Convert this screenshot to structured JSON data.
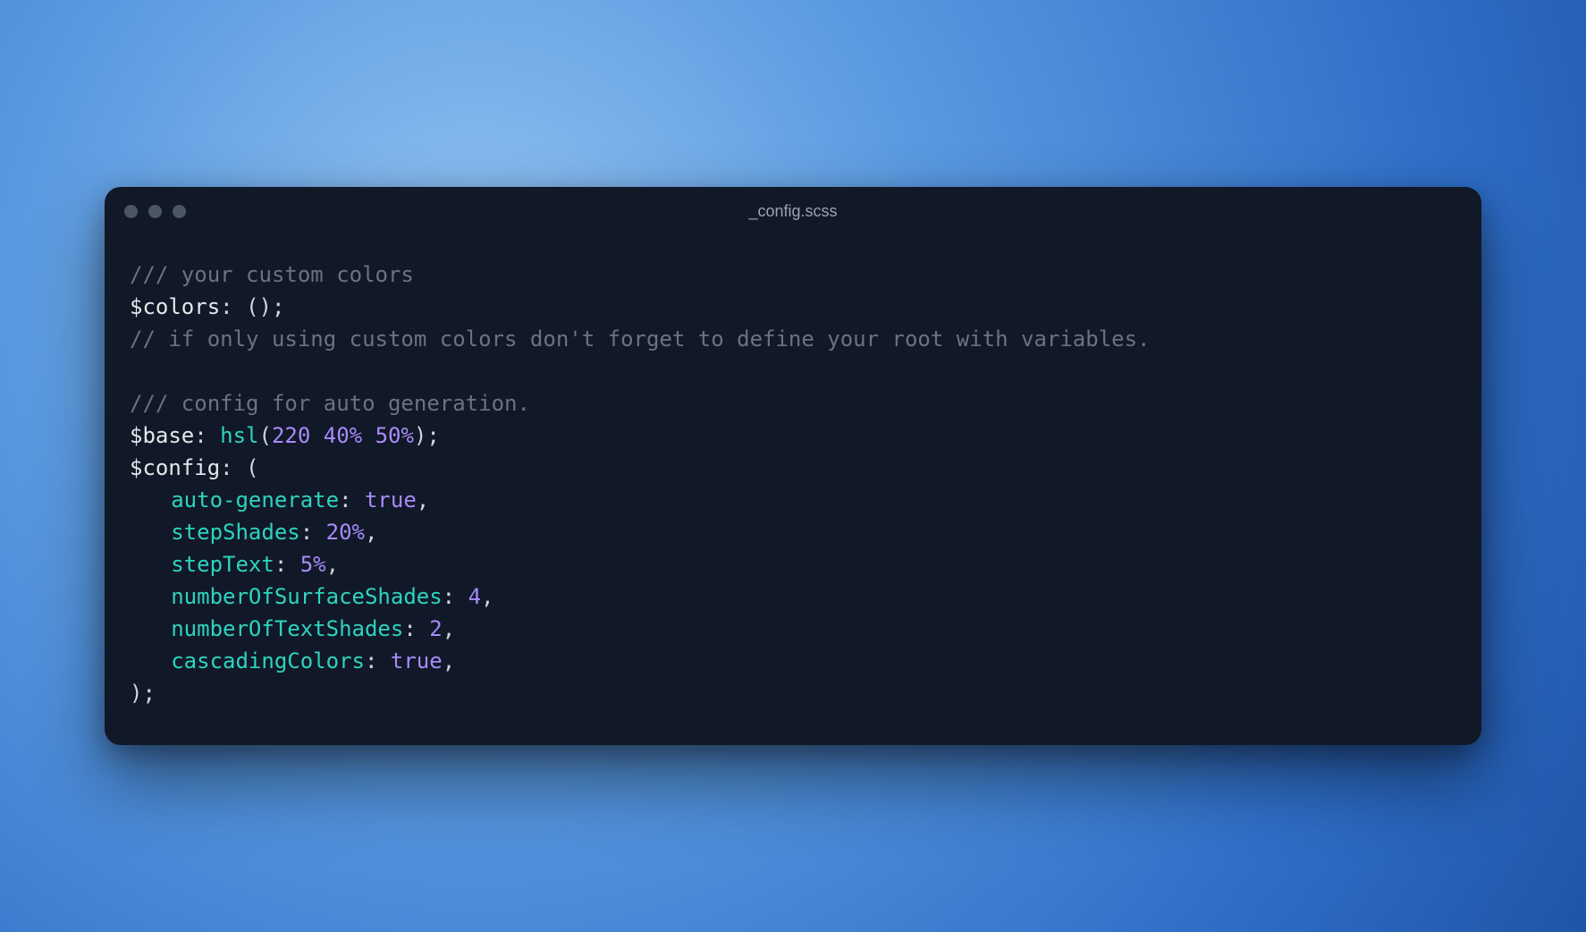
{
  "window": {
    "title": "_config.scss"
  },
  "code": {
    "comment1": "/// your custom colors",
    "var_colors": "$colors",
    "colors_rhs": "()",
    "comment2": "// if only using custom colors don't forget to define your root with variables.",
    "comment3": "/// config for auto generation.",
    "var_base": "$base",
    "fn_hsl": "hsl",
    "hsl_arg": "220 40% 50%",
    "var_config": "$config",
    "open_paren": "(",
    "close_paren_semi": ");",
    "entries": {
      "auto_generate": {
        "key": "auto-generate",
        "val": "true"
      },
      "stepShades": {
        "key": "stepShades",
        "val": "20%"
      },
      "stepText": {
        "key": "stepText",
        "val": "5%"
      },
      "numSurface": {
        "key": "numberOfSurfaceShades",
        "val": "4"
      },
      "numText": {
        "key": "numberOfTextShades",
        "val": "2"
      },
      "cascading": {
        "key": "cascadingColors",
        "val": "true"
      }
    }
  }
}
